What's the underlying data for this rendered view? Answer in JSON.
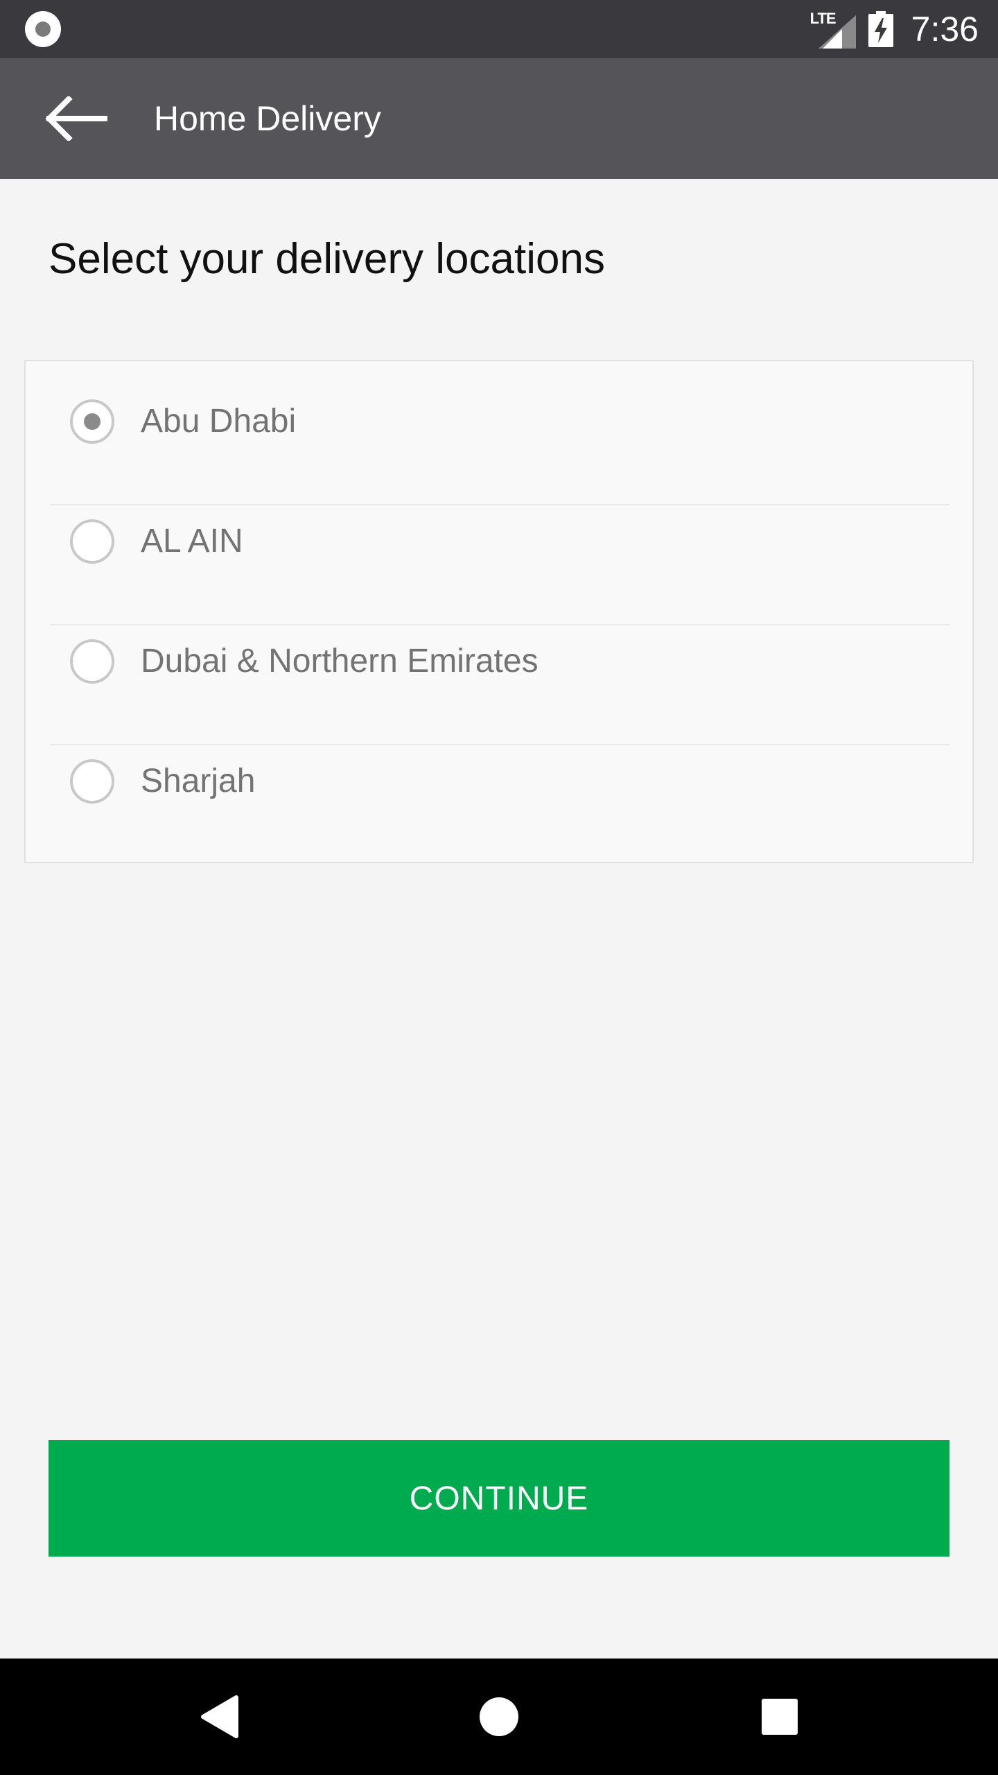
{
  "status_bar": {
    "network_label": "LTE",
    "time": "7:36"
  },
  "app_bar": {
    "title": "Home Delivery"
  },
  "page": {
    "heading": "Select your delivery locations"
  },
  "locations": [
    {
      "label": "Abu Dhabi",
      "selected": true
    },
    {
      "label": "AL AIN",
      "selected": false
    },
    {
      "label": "Dubai & Northern Emirates",
      "selected": false
    },
    {
      "label": "Sharjah",
      "selected": false
    }
  ],
  "actions": {
    "continue_label": "CONTINUE"
  },
  "colors": {
    "status_bar": "#3a3a3e",
    "app_bar": "#545459",
    "background": "#f4f4f4",
    "primary_button": "#00aa4f",
    "nav_bar": "#000000"
  }
}
